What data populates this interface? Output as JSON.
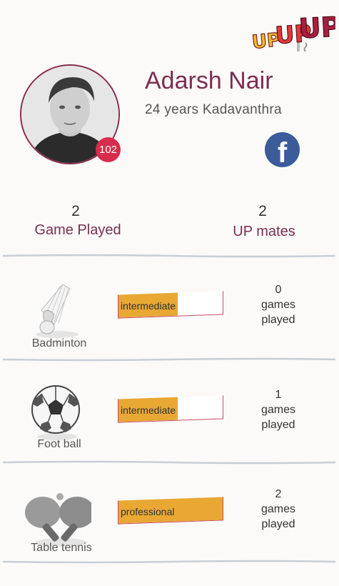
{
  "brand": {
    "logo_text": [
      "UP",
      "UP",
      "UP"
    ]
  },
  "profile": {
    "name": "Adarsh Nair",
    "subtitle": "24 years Kadavanthra",
    "badge": "102"
  },
  "stats": [
    {
      "value": "2",
      "label": "Game Played"
    },
    {
      "value": "2",
      "label": "UP mates"
    }
  ],
  "sports": [
    {
      "name": "Badminton",
      "icon": "shuttlecock-icon",
      "level": "intermediate",
      "level_fraction": 0.57,
      "games_count": "0",
      "games_line1": "games",
      "games_line2": "played"
    },
    {
      "name": "Foot ball",
      "icon": "football-icon",
      "level": "intermediate",
      "level_fraction": 0.57,
      "games_count": "1",
      "games_line1": "games",
      "games_line2": "played"
    },
    {
      "name": "Table tennis",
      "icon": "table-tennis-icon",
      "level": "professional",
      "level_fraction": 1.0,
      "games_count": "2",
      "games_line1": "games",
      "games_line2": "played"
    }
  ],
  "colors": {
    "accent": "#7c2d52",
    "badge": "#d82c4c",
    "facebook": "#3b5b9b",
    "level_fill": "#e8a833",
    "level_border": "#c94a6a"
  }
}
